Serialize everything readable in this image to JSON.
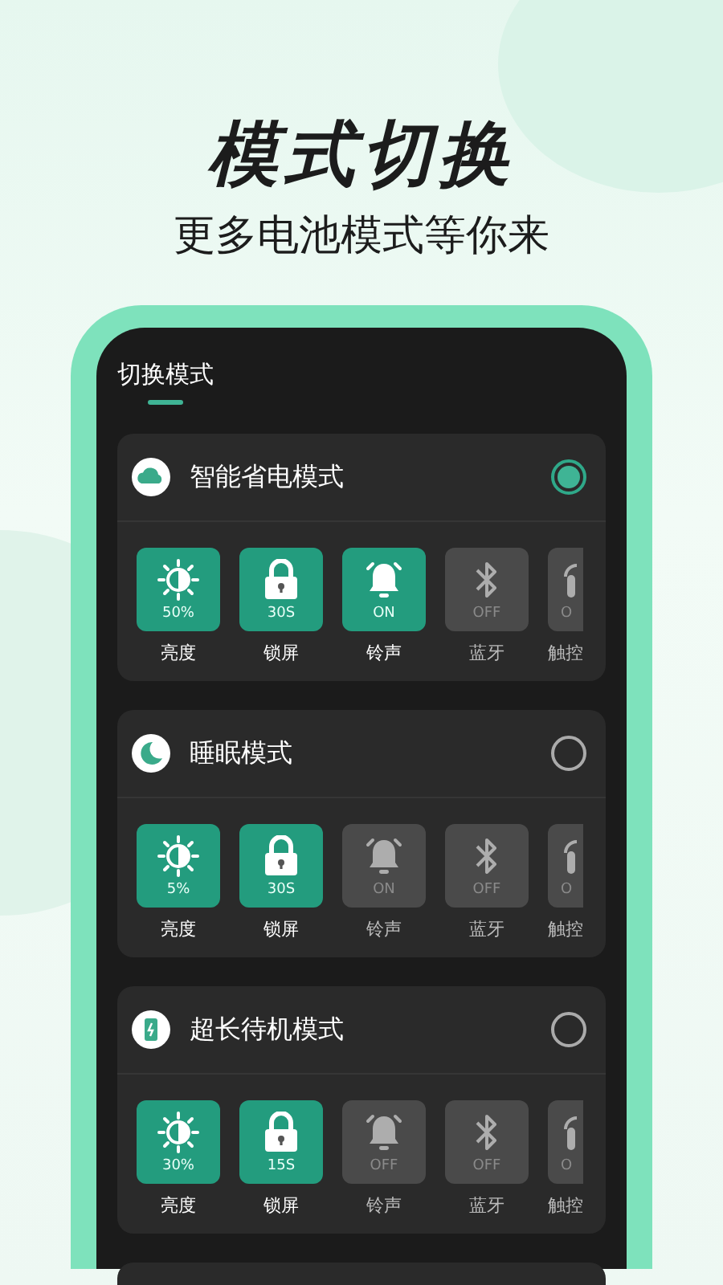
{
  "headline": "模式切换",
  "subtitle": "更多电池模式等你来",
  "tabs": [
    {
      "label": "切换模式",
      "selected": true
    }
  ],
  "modes": [
    {
      "name": "智能省电模式",
      "kind": "cloud",
      "selected": true,
      "tiles": [
        {
          "kind": "brightness",
          "value": "50%",
          "label": "亮度",
          "on": true
        },
        {
          "kind": "lock",
          "value": "30S",
          "label": "锁屏",
          "on": true
        },
        {
          "kind": "bell",
          "value": "ON",
          "label": "铃声",
          "on": true
        },
        {
          "kind": "bluetooth",
          "value": "OFF",
          "label": "蓝牙",
          "on": false
        },
        {
          "kind": "touch",
          "value": "O",
          "label": "触控",
          "on": false
        }
      ]
    },
    {
      "name": "睡眠模式",
      "kind": "moon",
      "selected": false,
      "tiles": [
        {
          "kind": "brightness",
          "value": "5%",
          "label": "亮度",
          "on": true
        },
        {
          "kind": "lock",
          "value": "30S",
          "label": "锁屏",
          "on": true
        },
        {
          "kind": "bell",
          "value": "ON",
          "label": "铃声",
          "on": false
        },
        {
          "kind": "bluetooth",
          "value": "OFF",
          "label": "蓝牙",
          "on": false
        },
        {
          "kind": "touch",
          "value": "O",
          "label": "触控",
          "on": false
        }
      ]
    },
    {
      "name": "超长待机模式",
      "kind": "battery",
      "selected": false,
      "tiles": [
        {
          "kind": "brightness",
          "value": "30%",
          "label": "亮度",
          "on": true
        },
        {
          "kind": "lock",
          "value": "15S",
          "label": "锁屏",
          "on": true
        },
        {
          "kind": "bell",
          "value": "OFF",
          "label": "铃声",
          "on": false
        },
        {
          "kind": "bluetooth",
          "value": "OFF",
          "label": "蓝牙",
          "on": false
        },
        {
          "kind": "touch",
          "value": "O",
          "label": "触控",
          "on": false
        }
      ]
    }
  ]
}
